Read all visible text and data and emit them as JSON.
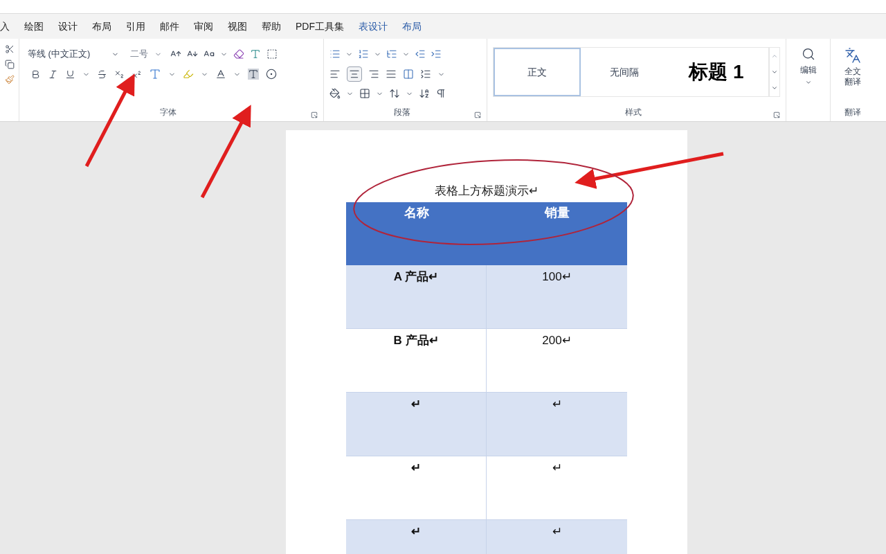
{
  "tabs": [
    {
      "label": "入",
      "kind": "standard",
      "selected": false
    },
    {
      "label": "绘图",
      "kind": "standard",
      "selected": false
    },
    {
      "label": "设计",
      "kind": "standard",
      "selected": false
    },
    {
      "label": "布局",
      "kind": "standard",
      "selected": false
    },
    {
      "label": "引用",
      "kind": "standard",
      "selected": false
    },
    {
      "label": "邮件",
      "kind": "standard",
      "selected": false
    },
    {
      "label": "审阅",
      "kind": "standard",
      "selected": false
    },
    {
      "label": "视图",
      "kind": "standard",
      "selected": false
    },
    {
      "label": "帮助",
      "kind": "standard",
      "selected": false
    },
    {
      "label": "PDF工具集",
      "kind": "standard",
      "selected": false
    },
    {
      "label": "表设计",
      "kind": "contextual",
      "selected": false
    },
    {
      "label": "布局",
      "kind": "contextual",
      "selected": false
    }
  ],
  "ribbon": {
    "font": {
      "font_name": "等线 (中文正文)",
      "font_size": "二号",
      "label": "字体"
    },
    "paragraph": {
      "label": "段落"
    },
    "styles": {
      "items": [
        {
          "label": "正文",
          "kind": "normal",
          "selected": true
        },
        {
          "label": "无间隔",
          "kind": "normal",
          "selected": false
        },
        {
          "label": "标题 1",
          "kind": "heading",
          "selected": false
        }
      ],
      "label": "样式"
    },
    "editing": {
      "button": "编辑"
    },
    "translate": {
      "button": "全文翻译",
      "label": "翻译"
    }
  },
  "document": {
    "caption": "表格上方标题演示↵",
    "table": {
      "columns": [
        "名称",
        "销量"
      ],
      "rows": [
        [
          "A 产品↵",
          "100↵"
        ],
        [
          "B 产品↵",
          "200↵"
        ],
        [
          "↵",
          "↵"
        ],
        [
          "↵",
          "↵"
        ],
        [
          "↵",
          "↵"
        ]
      ]
    }
  }
}
